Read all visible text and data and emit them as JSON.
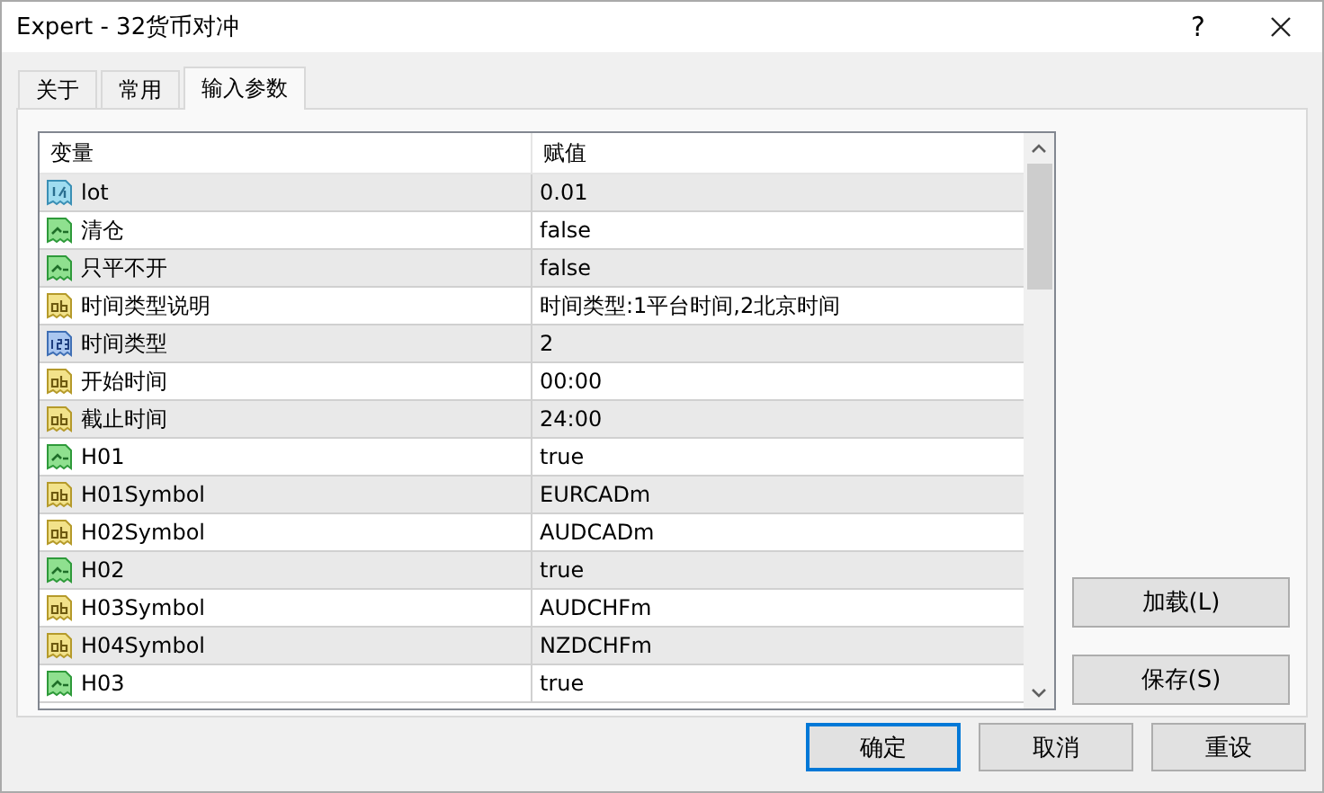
{
  "window": {
    "title": "Expert - 32货币对冲",
    "help": "?"
  },
  "tabs": [
    {
      "label": "关于",
      "selected": false
    },
    {
      "label": "常用",
      "selected": false
    },
    {
      "label": "输入参数",
      "selected": true
    }
  ],
  "table": {
    "columns": [
      "变量",
      "赋值"
    ],
    "rows": [
      {
        "kind": "double",
        "name": "lot",
        "value": "0.01"
      },
      {
        "kind": "bool",
        "name": "清仓",
        "value": "false"
      },
      {
        "kind": "bool",
        "name": "只平不开",
        "value": "false"
      },
      {
        "kind": "string",
        "name": "时间类型说明",
        "value": "时间类型:1平台时间,2北京时间"
      },
      {
        "kind": "int",
        "name": "时间类型",
        "value": "2"
      },
      {
        "kind": "string",
        "name": "开始时间",
        "value": "00:00"
      },
      {
        "kind": "string",
        "name": "截止时间",
        "value": "24:00"
      },
      {
        "kind": "bool",
        "name": "H01",
        "value": "true"
      },
      {
        "kind": "string",
        "name": "H01Symbol",
        "value": "EURCADm"
      },
      {
        "kind": "string",
        "name": "H02Symbol",
        "value": "AUDCADm"
      },
      {
        "kind": "bool",
        "name": "H02",
        "value": "true"
      },
      {
        "kind": "string",
        "name": "H03Symbol",
        "value": "AUDCHFm"
      },
      {
        "kind": "string",
        "name": "H04Symbol",
        "value": "NZDCHFm"
      },
      {
        "kind": "bool",
        "name": "H03",
        "value": "true"
      }
    ]
  },
  "side_buttons": [
    "加载(L)",
    "保存(S)"
  ],
  "buttons": [
    {
      "label": "确定",
      "default": true
    },
    {
      "label": "取消",
      "default": false
    },
    {
      "label": "重设",
      "default": false
    }
  ]
}
